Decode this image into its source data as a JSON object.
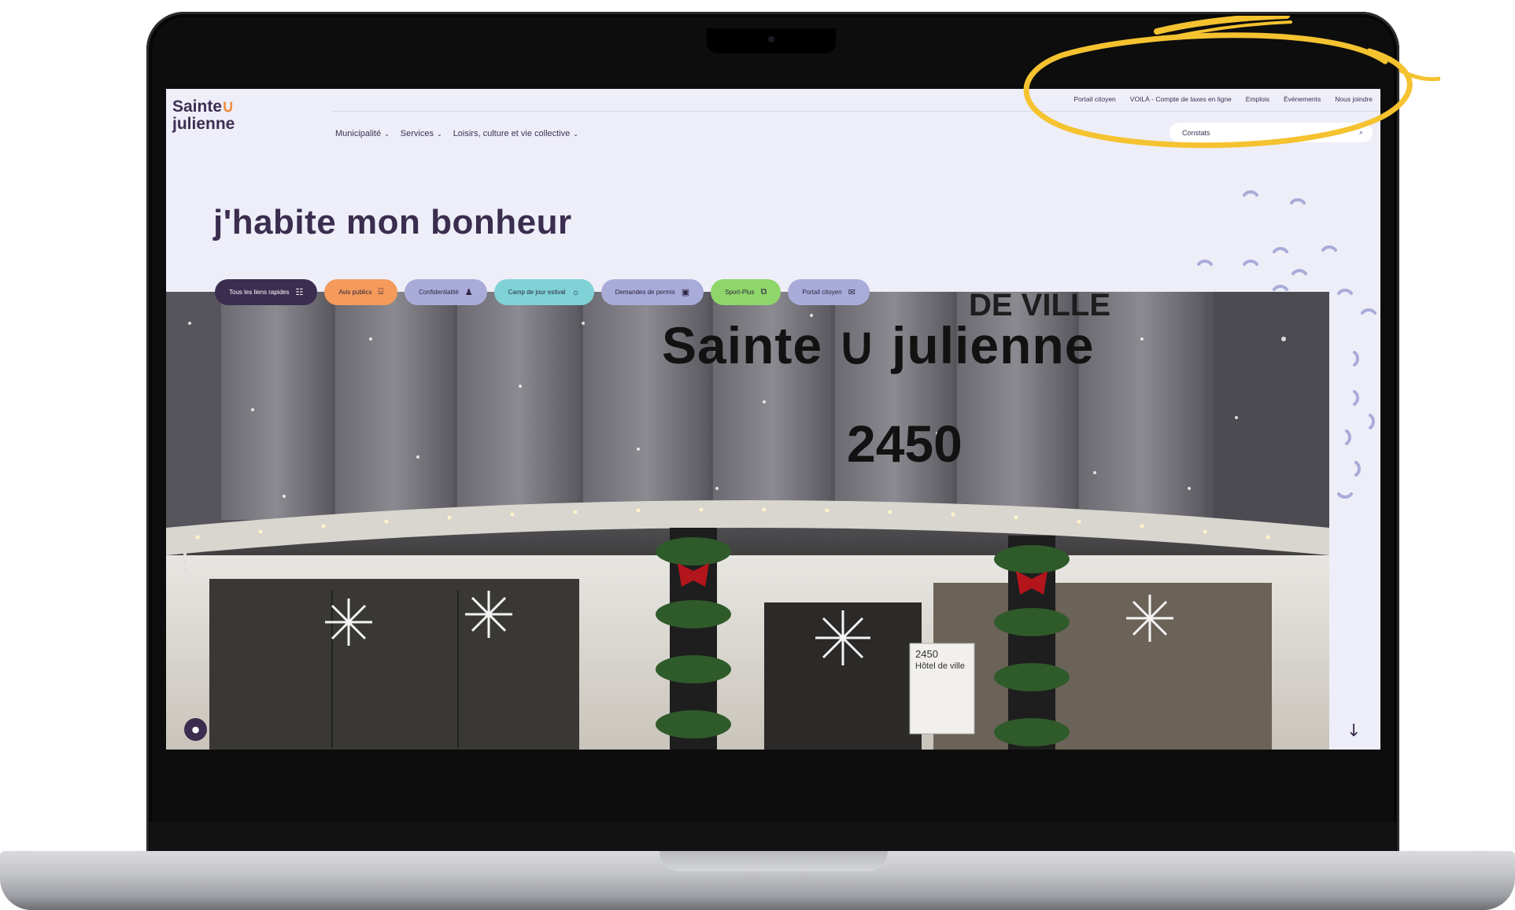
{
  "site": {
    "logo_line1": "Sainte",
    "logo_smile": "∪",
    "logo_line2": "julienne"
  },
  "utility_nav": [
    "Portail citoyen",
    "VOILÀ - Compte de taxes en ligne",
    "Emplois",
    "Événements",
    "Nous joindre"
  ],
  "main_nav": [
    {
      "label": "Municipalité",
      "chevron": "⌄"
    },
    {
      "label": "Services",
      "chevron": "⌄"
    },
    {
      "label": "Loisirs, culture et vie collective",
      "chevron": "⌄"
    }
  ],
  "search": {
    "value": "Constats",
    "icon": "search-icon"
  },
  "hero": {
    "title": "j'habite mon bonheur",
    "building_sign_top": "DE VILLE",
    "building_sign_name": "Sainte ∪ julienne",
    "building_number": "2450",
    "door_plaque_number": "2450",
    "door_plaque_label": "Hôtel de ville"
  },
  "quick_links": [
    {
      "label": "Tous les liens rapides",
      "icon": "grid-icon",
      "bg": "#3b2d4f",
      "fg": "#ffffff"
    },
    {
      "label": "Avis publics",
      "icon": "document-icon",
      "bg": "#f49a5a",
      "fg": "#2e2340"
    },
    {
      "label": "Confidentialité",
      "icon": "user-lock-icon",
      "bg": "#a9abd9",
      "fg": "#2e2340"
    },
    {
      "label": "Camp de jour estival",
      "icon": "sun-icon",
      "bg": "#7fd3d7",
      "fg": "#2e2340"
    },
    {
      "label": "Demandes de permis",
      "icon": "monitor-icon",
      "bg": "#a9abd9",
      "fg": "#2e2340"
    },
    {
      "label": "Sport-Plus",
      "icon": "screens-icon",
      "bg": "#8fd66a",
      "fg": "#2e2340"
    },
    {
      "label": "Portail citoyen",
      "icon": "megaphone-icon",
      "bg": "#a9abd9",
      "fg": "#2e2340"
    }
  ],
  "icons": {
    "grid": "☷",
    "document": "⌸",
    "user_lock": "♟",
    "sun": "☼",
    "monitor": "▣",
    "screens": "⧉",
    "megaphone": "✉",
    "search": "⌕",
    "chat": "●",
    "down_arrow": "↓"
  },
  "colors": {
    "brand_dark": "#3b2d4f",
    "accent_orange": "#f08a3c",
    "highlight_yellow": "#f5c230",
    "screen_bg": "#eeeef8"
  }
}
